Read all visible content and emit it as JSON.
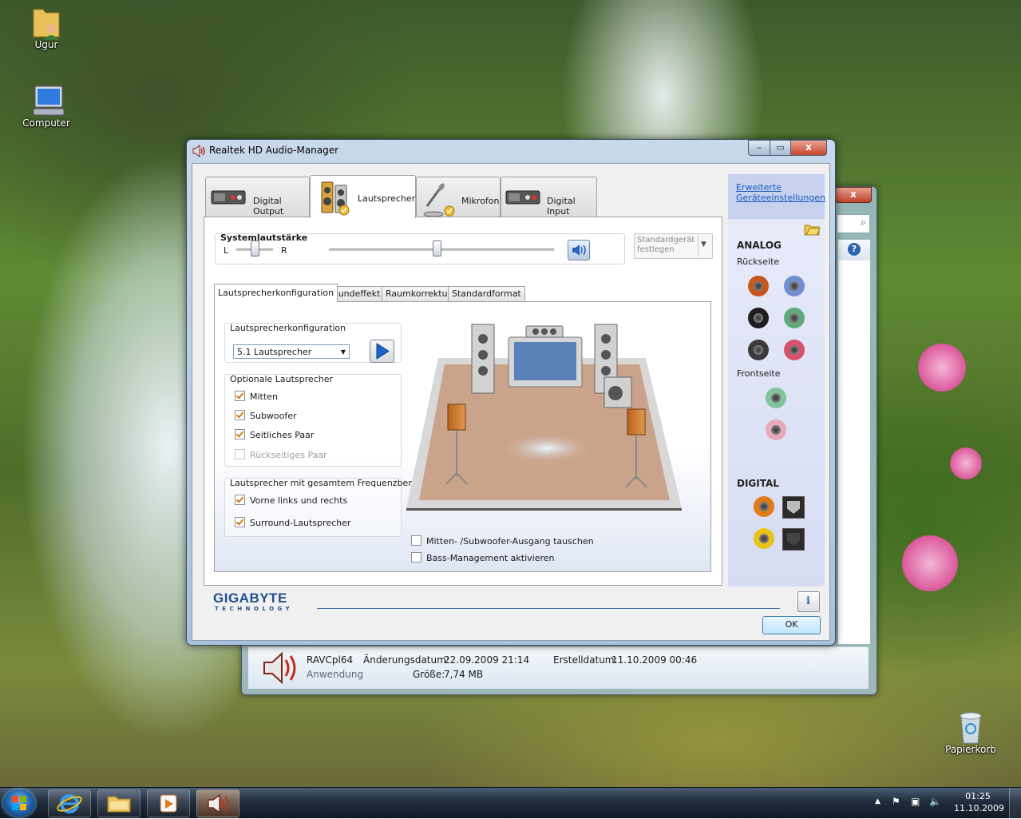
{
  "desktop": {
    "icons": [
      {
        "label": "Ugur"
      },
      {
        "label": "Computer"
      },
      {
        "label": "Papierkorb"
      }
    ]
  },
  "explorer_details": {
    "file_name": "RAVCpl64",
    "file_type": "Anwendung",
    "modified_label": "Änderungsdatum:",
    "modified_value": "22.09.2009 21:14",
    "size_label": "Größe:",
    "size_value": "7,74 MB",
    "created_label": "Erstelldatum:",
    "created_value": "11.10.2009 00:46"
  },
  "window": {
    "title": "Realtek HD Audio-Manager",
    "close_glyph": "x"
  },
  "device_tabs": [
    {
      "label": "Digital Output",
      "active": false
    },
    {
      "label": "Lautsprecher",
      "active": true
    },
    {
      "label": "Mikrofon",
      "active": false
    },
    {
      "label": "Digital Input",
      "active": false
    }
  ],
  "system_volume": {
    "title": "Systemlautstärke",
    "left": "L",
    "right": "R",
    "balance": 0.5,
    "volume": 0.48
  },
  "default_device_button": {
    "line1": "Standardgerät",
    "line2": "festlegen"
  },
  "sub_tabs": [
    {
      "label": "Lautsprecherkonfiguration",
      "active": true
    },
    {
      "label": "Soundeffekt",
      "active": false
    },
    {
      "label": "Raumkorrektur",
      "active": false
    },
    {
      "label": "Standardformat",
      "active": false
    }
  ],
  "speaker_config": {
    "group_title": "Lautsprecherkonfiguration",
    "selected": "5.1 Lautsprecher"
  },
  "optional_speakers": {
    "group_title": "Optionale Lautsprecher",
    "items": [
      {
        "label": "Mitten",
        "checked": true,
        "enabled": true
      },
      {
        "label": "Subwoofer",
        "checked": true,
        "enabled": true
      },
      {
        "label": "Seitliches Paar",
        "checked": true,
        "enabled": true
      },
      {
        "label": "Rückseitiges Paar",
        "checked": false,
        "enabled": false
      }
    ]
  },
  "fullrange_speakers": {
    "group_title": "Lautsprecher mit gesamtem Frequenzbereich",
    "items": [
      {
        "label": "Vorne links und rechts",
        "checked": true
      },
      {
        "label": "Surround-Lautsprecher",
        "checked": true
      }
    ]
  },
  "bottom_options": [
    {
      "label": "Mitten- /Subwoofer-Ausgang tauschen",
      "checked": false
    },
    {
      "label": "Bass-Management aktivieren",
      "checked": false
    }
  ],
  "side_panel": {
    "advanced_link": "Erweiterte Geräteeinstellungen",
    "analog_title": "ANALOG",
    "rear_label": "Rückseite",
    "front_label": "Frontseite",
    "digital_title": "DIGITAL",
    "rear_jack_colors": [
      "#c7561a",
      "#6f8fcf",
      "#1e1e1e",
      "#5fa97a",
      "#3a3a3a",
      "#d9506a"
    ],
    "front_jack_colors": [
      "#7fc49a",
      "#e9a9bd"
    ]
  },
  "footer": {
    "brand": "GIGABYTE",
    "brand_sub": "TECHNOLOGY",
    "ok_label": "OK",
    "info_icon": "i"
  },
  "taskbar": {
    "time": "01:25",
    "date": "11.10.2009"
  }
}
